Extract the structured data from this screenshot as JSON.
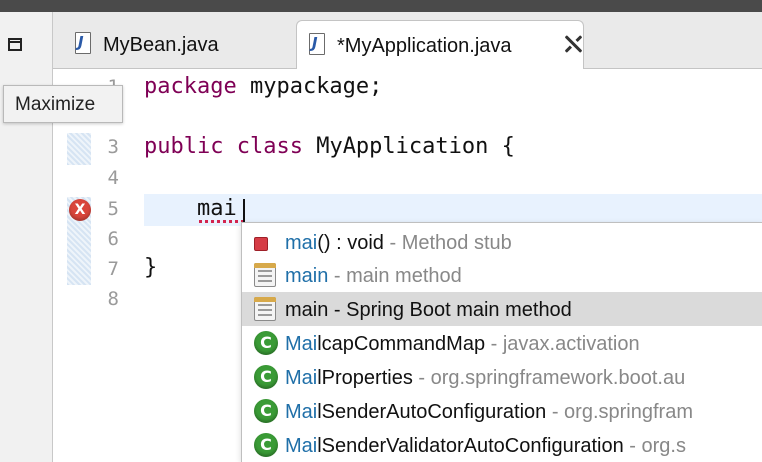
{
  "tooltip": {
    "text": "Maximize"
  },
  "tabs": [
    {
      "label": "MyBean.java",
      "icon": "java-file-icon",
      "active": false
    },
    {
      "label": "*MyApplication.java",
      "icon": "java-file-icon",
      "active": true
    }
  ],
  "editor": {
    "line_numbers": [
      "1",
      "2",
      "3",
      "4",
      "5",
      "6",
      "7",
      "8"
    ],
    "lines": [
      {
        "keyword": "package",
        "rest": " mypackage;"
      },
      {
        "keyword": "public class",
        "rest": " MyApplication {"
      },
      {
        "text": "    mai"
      },
      {
        "text": "}"
      }
    ],
    "error_marker": "X"
  },
  "content_assist": {
    "proposals": [
      {
        "icon": "method-icon",
        "primary": "mai",
        "detail": "() : void",
        "qualifier": " - Method stub"
      },
      {
        "icon": "template-icon",
        "primary": "main",
        "detail": "",
        "qualifier": " - main method"
      },
      {
        "icon": "template-icon",
        "primary": "main - Spring Boot main method",
        "detail": "",
        "qualifier": "",
        "selected": true
      },
      {
        "icon": "class-icon",
        "primary": "Mai",
        "detail": "lcapCommandMap",
        "qualifier": " - javax.activation"
      },
      {
        "icon": "class-icon",
        "primary": "Mai",
        "detail": "lProperties",
        "qualifier": " - org.springframework.boot.au"
      },
      {
        "icon": "class-icon",
        "primary": "Mai",
        "detail": "lSenderAutoConfiguration",
        "qualifier": " - org.springfram"
      },
      {
        "icon": "class-icon",
        "primary": "Mai",
        "detail": "lSenderValidatorAutoConfiguration",
        "qualifier": " - org.s"
      }
    ],
    "class_icon_letter": "C"
  },
  "colors": {
    "keyword": "#7f0055",
    "match": "#1f6fa8",
    "qualifier": "#888888",
    "current_line": "#e8f2fe",
    "selection": "#dadada"
  }
}
